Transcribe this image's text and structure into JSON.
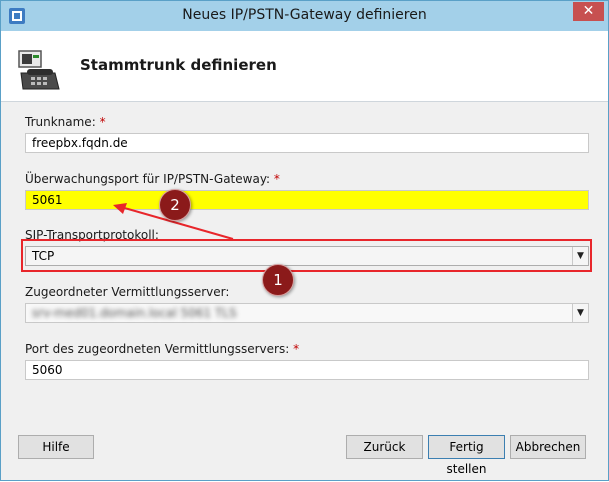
{
  "window": {
    "title": "Neues IP/PSTN-Gateway definieren",
    "close_glyph": "✕"
  },
  "header": {
    "title": "Stammtrunk definieren"
  },
  "fields": {
    "trunk_name": {
      "label": "Trunkname:",
      "required_mark": "*",
      "value": "freepbx.fqdn.de"
    },
    "monitor_port": {
      "label": "Überwachungsport für IP/PSTN-Gateway:",
      "required_mark": "*",
      "value": "5061"
    },
    "sip_transport": {
      "label": "SIP-Transportprotokoll:",
      "value": "TCP"
    },
    "mediation_server": {
      "label": "Zugeordneter Vermittlungsserver:",
      "value": "srv-med01.domain.local 5061 TLS"
    },
    "mediation_port": {
      "label": "Port des zugeordneten Vermittlungsservers:",
      "required_mark": "*",
      "value": "5060"
    }
  },
  "annotations": {
    "marker1": "1",
    "marker2": "2"
  },
  "buttons": {
    "help": "Hilfe",
    "back": "Zurück",
    "finish": "Fertig stellen",
    "cancel": "Abbrechen"
  },
  "colors": {
    "titlebar": "#a3d0e9",
    "highlight": "#ffff00",
    "annotation": "#e8262b",
    "marker": "#8b1a1a"
  }
}
